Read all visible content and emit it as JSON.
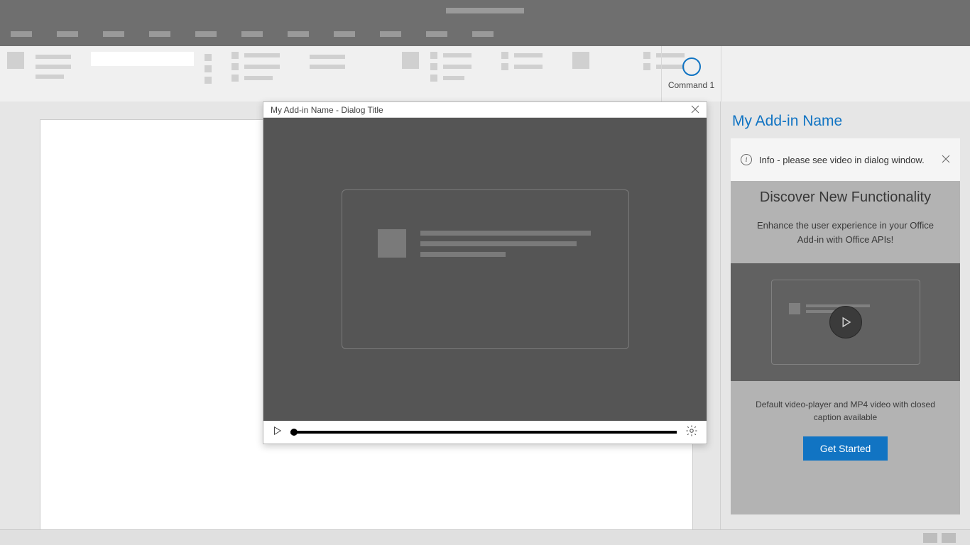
{
  "ribbon": {
    "command1_label": "Command 1"
  },
  "dialog": {
    "title": "My Add-in Name - Dialog Title"
  },
  "taskpane": {
    "title": "My Add-in Name",
    "info_text": "Info - please see video in dialog window.",
    "heading": "Discover New Functionality",
    "description": "Enhance the user experience in your Office Add-in with Office APIs!",
    "caption": "Default video-player and MP4 video with closed caption available",
    "button_label": "Get Started"
  }
}
